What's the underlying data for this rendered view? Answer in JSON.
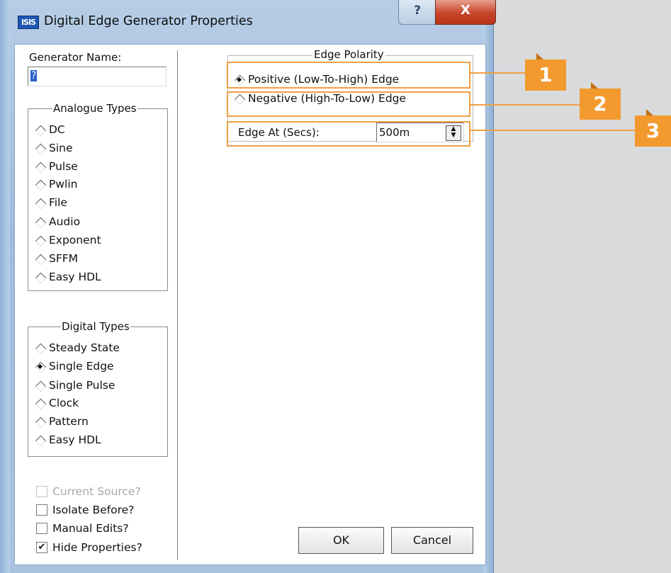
{
  "window": {
    "title": "Digital Edge Generator Properties",
    "icon_text": "ISIS",
    "help_label": "?",
    "close_label": "X"
  },
  "generator_name": {
    "label": "Generator Name:",
    "value": "?"
  },
  "analogue_types": {
    "label": "Analogue Types",
    "items": [
      "DC",
      "Sine",
      "Pulse",
      "Pwlin",
      "File",
      "Audio",
      "Exponent",
      "SFFM",
      "Easy HDL"
    ]
  },
  "digital_types": {
    "label": "Digital Types",
    "items": [
      "Steady State",
      "Single Edge",
      "Single Pulse",
      "Clock",
      "Pattern",
      "Easy HDL"
    ],
    "selected": "Single Edge"
  },
  "checkboxes": [
    {
      "label": "Current Source?",
      "checked": false,
      "enabled": false
    },
    {
      "label": "Isolate Before?",
      "checked": false,
      "enabled": true
    },
    {
      "label": "Manual Edits?",
      "checked": false,
      "enabled": true
    },
    {
      "label": "Hide Properties?",
      "checked": true,
      "enabled": true
    }
  ],
  "edge_polarity": {
    "label": "Edge Polarity",
    "positive": "Positive (Low-To-High) Edge",
    "negative": "Negative (High-To-Low) Edge",
    "selected": "positive"
  },
  "edge_at": {
    "label": "Edge At (Secs):",
    "value": "500m"
  },
  "buttons": {
    "ok": "OK",
    "cancel": "Cancel"
  },
  "callouts": [
    "1",
    "2",
    "3"
  ],
  "colors": {
    "callout": "#f29a2e",
    "selection": "#2a61c9",
    "close": "#c8452c"
  }
}
